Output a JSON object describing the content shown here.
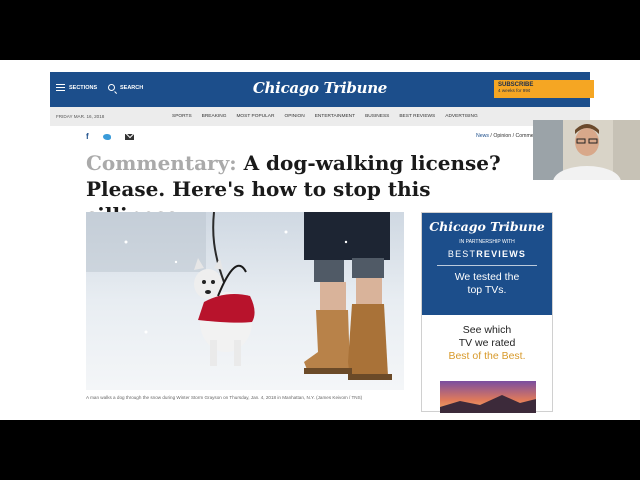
{
  "header": {
    "sections_label": "SECTIONS",
    "search_label": "SEARCH",
    "logo_text": "Chicago Tribune",
    "subscribe_label": "SUBSCRIBE",
    "subscribe_sub": "4 weeks for 99¢"
  },
  "navbar": {
    "date": "FRIDAY MAR. 16, 2018",
    "links": [
      "SPORTS",
      "BREAKING",
      "MOST POPULAR",
      "OPINION",
      "ENTERTAINMENT",
      "BUSINESS",
      "BEST REVIEWS",
      "ADVERTISING"
    ]
  },
  "share": {
    "icons": [
      "facebook-icon",
      "twitter-icon",
      "email-icon"
    ]
  },
  "breadcrumb": {
    "news": "News",
    "sep1": " / ",
    "opinion": "Opinion",
    "sep2": " / ",
    "commentary": "Commentary"
  },
  "article": {
    "kicker": "Commentary:",
    "headline_line1": "A dog-walking license?",
    "headline_line2": "Please. Here's how to stop this silliness.",
    "caption": "A man walks a dog through the snow during Winter Storm Grayson on Thursday, Jan. 4, 2018 in Manhattan, N.Y. (James Keivom / TNS)"
  },
  "ad": {
    "logo_text": "Chicago Tribune",
    "partnership": "IN PARTNERSHIP WITH",
    "brand_best": "BEST",
    "brand_reviews": "REVIEWS",
    "tested_line1": "We tested the",
    "tested_line2": "top TVs.",
    "see_line1": "See which",
    "see_line2": "TV we rated",
    "best_of_best": "Best of the Best."
  },
  "colors": {
    "brand_blue": "#1c4e8b",
    "subscribe_orange": "#f5a623",
    "kicker_gray": "#aaaaaa",
    "best_gold": "#d89a2b"
  }
}
